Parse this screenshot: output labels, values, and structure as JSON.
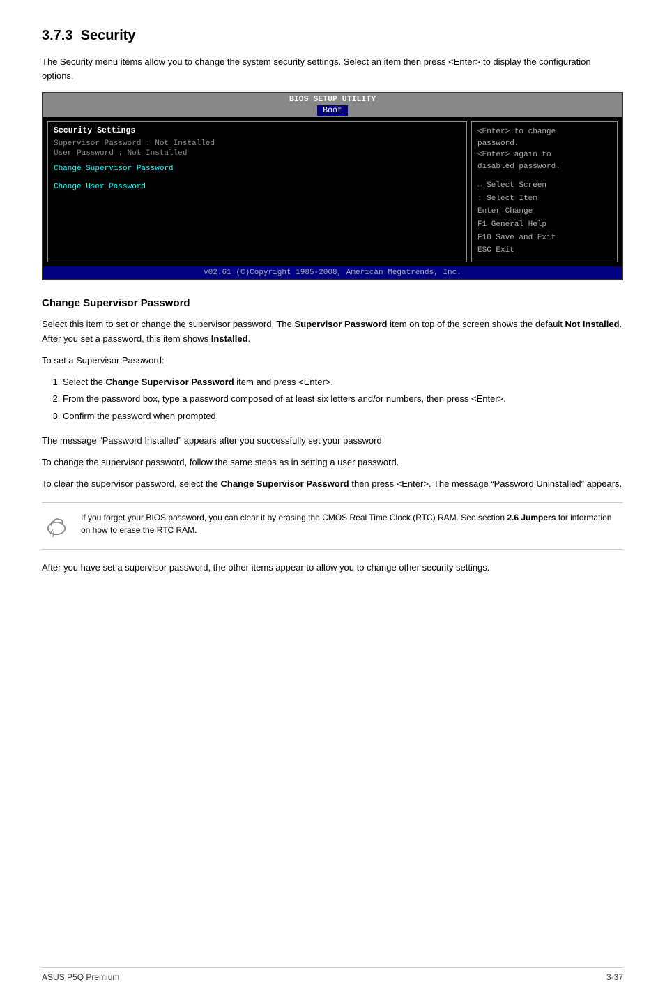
{
  "section": {
    "number": "3.7.3",
    "title": "Security",
    "intro": "The Security menu items allow you to change the system security settings. Select an item then press <Enter> to display the configuration options."
  },
  "bios": {
    "header": "BIOS SETUP UTILITY",
    "tab": "Boot",
    "left": {
      "section_label": "Security Settings",
      "supervisor_label": "Supervisor Password",
      "supervisor_value": ": Not Installed",
      "user_label": "User Password",
      "user_value": ": Not Installed",
      "action1": "Change Supervisor Password",
      "action2": "Change User Password"
    },
    "right": {
      "help_line1": "<Enter> to change",
      "help_line2": "password.",
      "help_line3": "<Enter> again to",
      "help_line4": "disabled password.",
      "key1": "↔  Select Screen",
      "key2": "↕  Select Item",
      "key3": "Enter Change",
      "key4": "F1   General Help",
      "key5": "F10  Save and Exit",
      "key6": "ESC  Exit"
    },
    "footer": "v02.61 (C)Copyright 1985-2008, American Megatrends, Inc."
  },
  "change_supervisor": {
    "heading": "Change Supervisor Password",
    "para1": "Select this item to set or change the supervisor password. The ",
    "para1_bold1": "Supervisor Password",
    "para1_mid": " item on top of the screen shows the default ",
    "para1_bold2": "Not Installed",
    "para1_end": ". After you set a password, this item shows ",
    "para1_bold3": "Installed",
    "para1_period": ".",
    "para2": "To set a Supervisor Password:",
    "steps": [
      {
        "num": 1,
        "text_pre": "Select the ",
        "text_bold": "Change Supervisor Password",
        "text_post": " item and press <Enter>."
      },
      {
        "num": 2,
        "text_pre": "From the password box, type a password composed of at least six letters and/or numbers, then press <Enter>.",
        "text_bold": "",
        "text_post": ""
      },
      {
        "num": 3,
        "text_pre": "Confirm the password when prompted.",
        "text_bold": "",
        "text_post": ""
      }
    ],
    "para3": "The message “Password Installed” appears after you successfully set your password.",
    "para4": "To change the supervisor password, follow the same steps as in setting a user password.",
    "para5_pre": "To clear the supervisor password, select the ",
    "para5_bold": "Change Supervisor Password",
    "para5_post": " then press <Enter>. The message “Password Uninstalled” appears.",
    "note": {
      "text_pre": "If you forget your BIOS password, you can clear it by erasing the CMOS Real Time Clock (RTC) RAM. See section ",
      "text_bold": "2.6 Jumpers",
      "text_post": " for information on how to erase the RTC RAM."
    },
    "para6": "After you have set a supervisor password, the other items appear to allow you to change other security settings."
  },
  "footer": {
    "left": "ASUS P5Q Premium",
    "right": "3-37"
  }
}
